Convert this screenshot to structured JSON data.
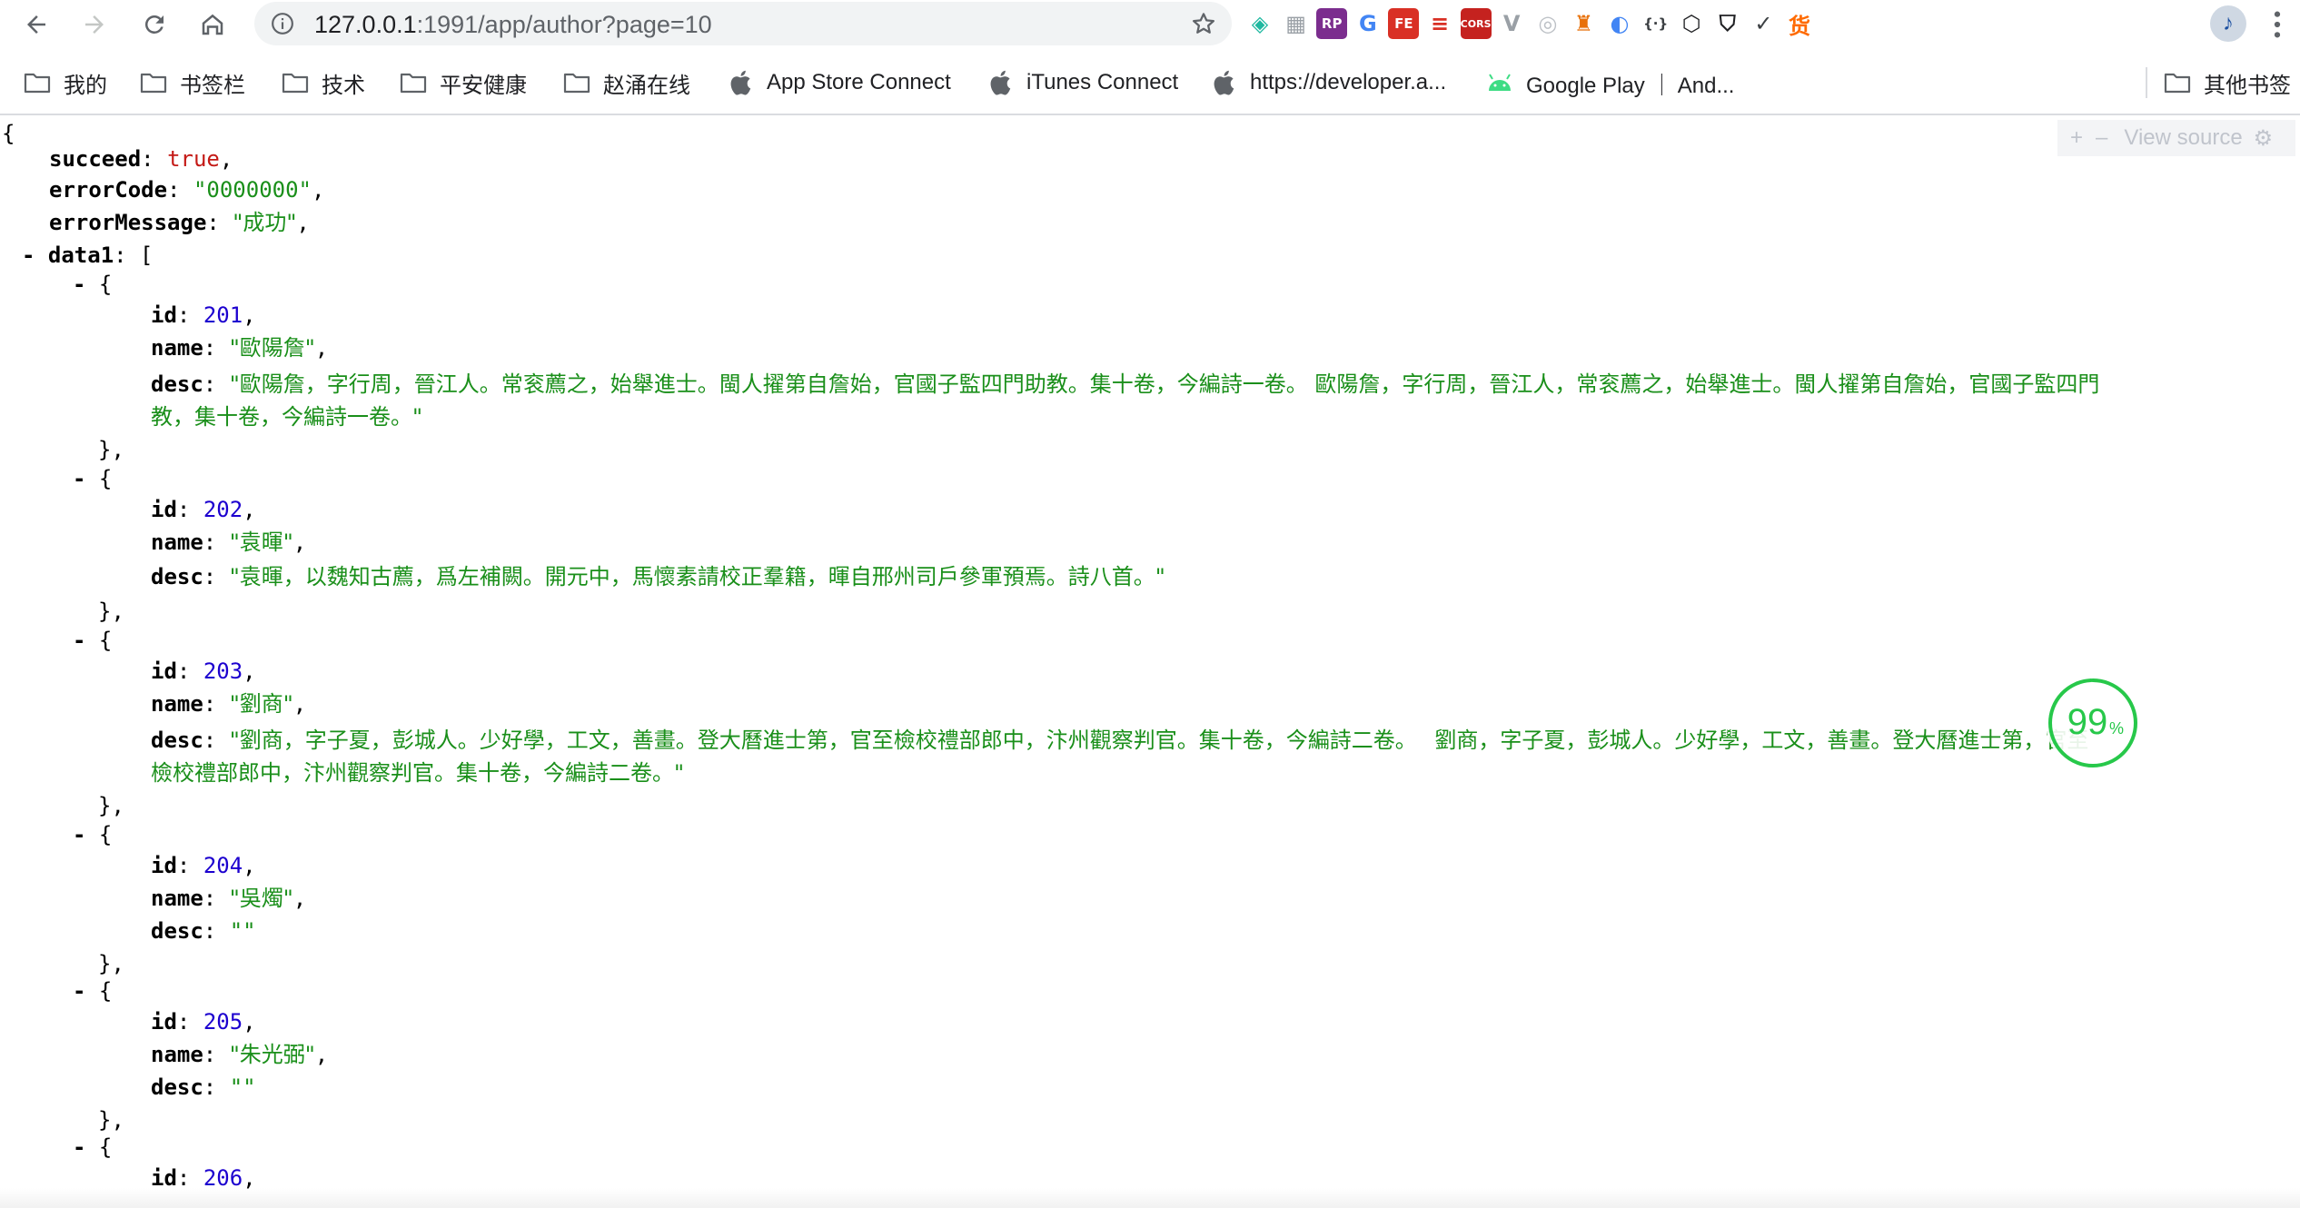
{
  "browser": {
    "url_host": "127.0.0.1",
    "url_rest": ":1991/app/author?page=10",
    "extensions": [
      {
        "name": "diamond-extension-icon",
        "glyph": "◈",
        "color": "#1fb8a0"
      },
      {
        "name": "qr-extension-icon",
        "glyph": "▦",
        "color": "#9aa0a6"
      },
      {
        "name": "rp-extension-icon",
        "glyph": "RP",
        "color": "#7b2d8e"
      },
      {
        "name": "translate-extension-icon",
        "glyph": "G",
        "color": "#4285f4"
      },
      {
        "name": "fe-extension-icon",
        "glyph": "FE",
        "color": "#d93025"
      },
      {
        "name": "stripes-extension-icon",
        "glyph": "≡",
        "color": "#d93025"
      },
      {
        "name": "cors-extension-icon",
        "glyph": "CORS",
        "color": "#c5221f"
      },
      {
        "name": "vue-extension-icon",
        "glyph": "V",
        "color": "#9aa0a6"
      },
      {
        "name": "target-extension-icon",
        "glyph": "◎",
        "color": "#bdc1c6"
      },
      {
        "name": "lighthouse-extension-icon",
        "glyph": "♜",
        "color": "#e8710a"
      },
      {
        "name": "circle-extension-icon",
        "glyph": "◐",
        "color": "#4285f4"
      },
      {
        "name": "braces-extension-icon",
        "glyph": "{·}",
        "color": "#3c4043"
      },
      {
        "name": "cube-extension-icon",
        "glyph": "⬡",
        "color": "#202124"
      },
      {
        "name": "shield-extension-icon",
        "glyph": "⛉",
        "color": "#202124"
      },
      {
        "name": "check-extension-icon",
        "glyph": "✓",
        "color": "#3c4043"
      },
      {
        "name": "goods-extension-icon",
        "glyph": "货",
        "color": "#ff6a00"
      }
    ]
  },
  "bookmarks": [
    {
      "label": "我的",
      "type": "folder"
    },
    {
      "label": "书签栏",
      "type": "folder"
    },
    {
      "label": "技术",
      "type": "folder"
    },
    {
      "label": "平安健康",
      "type": "folder"
    },
    {
      "label": "赵涌在线",
      "type": "folder"
    },
    {
      "label": "App Store Connect",
      "type": "apple"
    },
    {
      "label": "iTunes Connect",
      "type": "apple"
    },
    {
      "label": "https://developer.a...",
      "type": "apple"
    },
    {
      "label": "Google Play ｜ And...",
      "type": "android"
    },
    {
      "label": "其他书签",
      "type": "folder"
    }
  ],
  "json_viewer": {
    "view_source_label": "View source",
    "plus": "+",
    "minus": "–",
    "progress_value": "99",
    "progress_unit": "%",
    "progress_fraction": 0.99
  },
  "response": {
    "succeed": "true",
    "errorCode": "\"0000000\"",
    "errorMessage": "\"成功\"",
    "data_key": "data1",
    "items": [
      {
        "id": "201",
        "name": "\"歐陽詹\"",
        "desc_line1": "\"歐陽詹，字行周，晉江人。常衮薦之，始舉進士。閩人擢第自詹始，官國子監四門助教。集十卷，今編詩一卷。 歐陽詹，字行周，晉江人，常衮薦之，始舉進士。閩人擢第自詹始，官國子監四門",
        "desc_line2": "教，集十卷，今編詩一卷。\""
      },
      {
        "id": "202",
        "name": "\"袁暉\"",
        "desc_line1": "\"袁暉，以魏知古薦，爲左補闕。開元中，馬懷素請校正羣籍，暉自邢州司戶參軍預焉。詩八首。\"",
        "desc_line2": ""
      },
      {
        "id": "203",
        "name": "\"劉商\"",
        "desc_line1": "\"劉商，字子夏，彭城人。少好學，工文，善畫。登大曆進士第，官至檢校禮部郎中，汴州觀察判官。集十卷，今編詩二卷。　 劉商，字子夏，彭城人。少好學，工文，善畫。登大曆進士第，官至",
        "desc_line2": "檢校禮部郎中，汴州觀察判官。集十卷，今編詩二卷。\""
      },
      {
        "id": "204",
        "name": "\"吳燭\"",
        "desc_line1": "\"\"",
        "desc_line2": ""
      },
      {
        "id": "205",
        "name": "\"朱光弼\"",
        "desc_line1": "\"\"",
        "desc_line2": ""
      },
      {
        "id": "206"
      }
    ]
  }
}
